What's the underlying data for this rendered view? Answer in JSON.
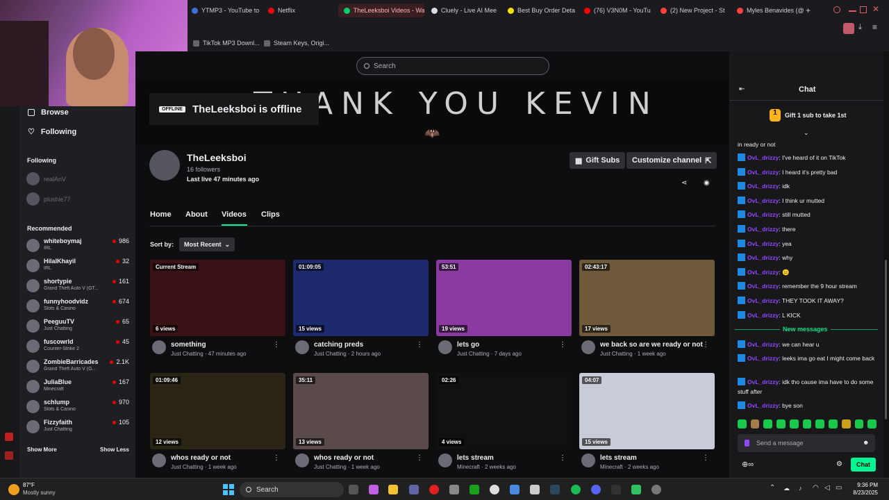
{
  "browser": {
    "tabs": [
      {
        "label": "YTMP3 - YouTube to",
        "color": "#3f6fd6",
        "active": false
      },
      {
        "label": "Netflix",
        "color": "#e50914",
        "active": false
      },
      {
        "label": "TheLeeksboi Videos - Wa",
        "color": "#00d26a",
        "active": true
      },
      {
        "label": "Cluely - Live AI Mee",
        "color": "#dcdcdc",
        "active": false
      },
      {
        "label": "Best Buy Order Deta",
        "color": "#ffe000",
        "active": false
      },
      {
        "label": "(76) V3N0M - YouTu",
        "color": "#ff0000",
        "active": false
      },
      {
        "label": "(2) New Project - St",
        "color": "#ff4040",
        "active": false
      },
      {
        "label": "Myles Benavides (@",
        "color": "#ff4040",
        "active": false
      }
    ],
    "new_tab": "+",
    "bookmarks": [
      "TikTok MP3 Downl...",
      "Steam Keys, Origi..."
    ]
  },
  "twitch": {
    "search_placeholder": "Search",
    "banner_text": "THANK YOU KEVIN",
    "offline_badge": "OFFLINE",
    "offline_title": "TheLeeksboi is offline",
    "nav": {
      "browse": "Browse",
      "following": "Following"
    },
    "following_section": "Following",
    "followed_channels": [
      "realAnV",
      "plushie77"
    ],
    "recommended_section": "Recommended",
    "recommended": [
      {
        "name": "whiteboymaj",
        "category": "IRL",
        "viewers": "986"
      },
      {
        "name": "HilalKhayil",
        "category": "IRL",
        "viewers": "32"
      },
      {
        "name": "shortypie",
        "category": "Grand Theft Auto V (GT...",
        "viewers": "161"
      },
      {
        "name": "funnyhoodvidz",
        "category": "Slots & Casino",
        "viewers": "674"
      },
      {
        "name": "PeeguuTV",
        "category": "Just Chatting",
        "viewers": "65"
      },
      {
        "name": "fuscowrld",
        "category": "Counter-Strike 2",
        "viewers": "45"
      },
      {
        "name": "ZombieBarricades",
        "category": "Grand Theft Auto V (G...",
        "viewers": "2.1K"
      },
      {
        "name": "JuliaBlue",
        "category": "Minecraft",
        "viewers": "167"
      },
      {
        "name": "schlump",
        "category": "Slots & Casino",
        "viewers": "970"
      },
      {
        "name": "Fizzyfaith",
        "category": "Just Chatting",
        "viewers": "105"
      }
    ],
    "show_more": "Show More",
    "show_less": "Show Less",
    "channel": {
      "name": "TheLeeksboi",
      "followers": "16 followers",
      "last_live": "Last live 47 minutes ago",
      "gift_subs": "Gift Subs",
      "customize": "Customize channel"
    },
    "tabs": [
      "Home",
      "About",
      "Videos",
      "Clips"
    ],
    "active_tab": "Videos",
    "sort_label": "Sort by:",
    "sort_value": "Most Recent",
    "videos": [
      {
        "duration": "Current Stream",
        "views": "6 views",
        "title": "something",
        "meta": "Just Chatting · 47 minutes ago",
        "thumb": "#3a1215"
      },
      {
        "duration": "01:09:05",
        "views": "15 views",
        "title": "catching preds",
        "meta": "Just Chatting · 2 hours ago",
        "thumb": "#1d2a6e"
      },
      {
        "duration": "53:51",
        "views": "19 views",
        "title": "lets go",
        "meta": "Just Chatting · 7 days ago",
        "thumb": "#8a3aa0"
      },
      {
        "duration": "02:43:17",
        "views": "17 views",
        "title": "we back so are we ready or not",
        "meta": "Just Chatting · 1 week ago",
        "thumb": "#6e5a3a"
      },
      {
        "duration": "01:09:46",
        "views": "12 views",
        "title": "whos ready or not",
        "meta": "Just Chatting · 1 week ago",
        "thumb": "#2a2415"
      },
      {
        "duration": "35:11",
        "views": "13 views",
        "title": "whos ready or not",
        "meta": "Just Chatting · 1 week ago",
        "thumb": "#5a4a4a"
      },
      {
        "duration": "02:26",
        "views": "4 views",
        "title": "lets stream",
        "meta": "Minecraft · 2 weeks ago",
        "thumb": "#111111"
      },
      {
        "duration": "04:07",
        "views": "15 views",
        "title": "lets stream",
        "meta": "Minecraft · 2 weeks ago",
        "thumb": "#c8ccd8"
      }
    ],
    "chat": {
      "title": "Chat",
      "gift_banner": "Gift 1 sub to take 1st",
      "first_line": "in ready or not",
      "messages": [
        {
          "user": "OvL_drizzy",
          "text": ": I've heard of it on TikTok"
        },
        {
          "user": "OvL_drizzy",
          "text": ": I heard it's pretty bad"
        },
        {
          "user": "OvL_drizzy",
          "text": ": idk"
        },
        {
          "user": "OvL_drizzy",
          "text": ": I think ur mutted"
        },
        {
          "user": "OvL_drizzy",
          "text": ": still mutted"
        },
        {
          "user": "OvL_drizzy",
          "text": ": there"
        },
        {
          "user": "OvL_drizzy",
          "text": ": yea"
        },
        {
          "user": "OvL_drizzy",
          "text": ": why"
        },
        {
          "user": "OvL_drizzy",
          "text": ": 😐"
        },
        {
          "user": "OvL_drizzy",
          "text": ": remember the 9 hour stream"
        },
        {
          "user": "OvL_drizzy",
          "text": ": THEY TOOK IT AWAY?"
        },
        {
          "user": "OvL_drizzy",
          "text": ": L KICK"
        }
      ],
      "new_messages_label": "New messages",
      "new_messages": [
        {
          "user": "OvL_drizzy",
          "text": ": we can hear u"
        },
        {
          "user": "OvL_drizzy",
          "text": ": leeks ima go eat I might come back"
        },
        {
          "user": "OvL_drizzy",
          "text": ": idk tho cause ima have to do some stuff after"
        },
        {
          "user": "OvL_drizzy",
          "text": ": bye son"
        }
      ],
      "input_placeholder": "Send a message",
      "send_label": "Chat"
    }
  },
  "taskbar": {
    "weather_temp": "87°F",
    "weather_desc": "Mostly sunny",
    "search": "Search",
    "time": "9:36 PM",
    "date": "8/23/2025"
  }
}
